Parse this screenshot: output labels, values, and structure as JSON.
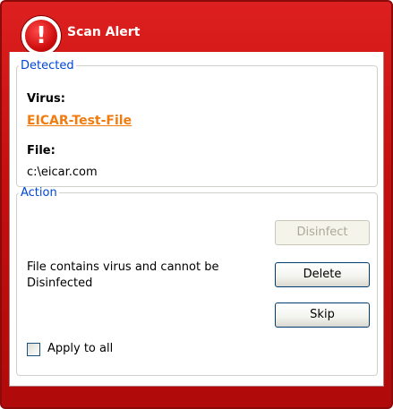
{
  "window": {
    "title": "Scan Alert",
    "alert_icon_glyph": "!",
    "accent_color": "#c40f0f",
    "icon": "alert-icon"
  },
  "detected": {
    "legend": "Detected",
    "virus_label": "Virus:",
    "virus_name": "EICAR-Test-File",
    "file_label": "File:",
    "file_path": "c:\\eicar.com"
  },
  "action": {
    "legend": "Action",
    "message_line1": "File contains virus and cannot be",
    "message_line2": "Disinfected",
    "buttons": {
      "disinfect": {
        "label": "Disinfect",
        "enabled": false
      },
      "delete": {
        "label": "Delete",
        "enabled": true
      },
      "skip": {
        "label": "Skip",
        "enabled": true
      }
    },
    "apply_to_all": {
      "label": "Apply to all",
      "checked": false
    }
  }
}
